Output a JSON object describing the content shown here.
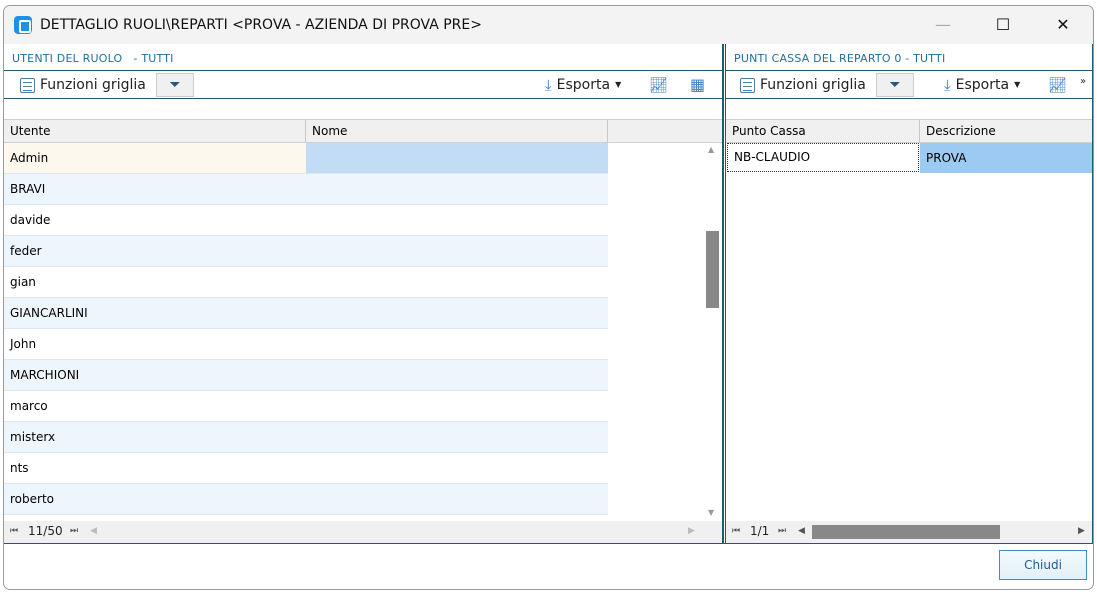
{
  "window": {
    "title": "DETTAGLIO RUOLI\\REPARTI <PROVA - AZIENDA DI PROVA PRE>",
    "minimize": "—",
    "maximize": "☐",
    "close": "✕"
  },
  "left": {
    "title": "UTENTI DEL RUOLO   - TUTTI",
    "grid_functions": "Funzioni griglia",
    "export": "Esporta",
    "columns": [
      "Utente",
      "Nome"
    ],
    "rows": [
      "Admin",
      "BRAVI",
      "davide",
      "feder",
      "gian",
      "GIANCARLINI",
      "John",
      "MARCHIONI",
      "marco",
      "misterx",
      "nts",
      "roberto"
    ],
    "pager": "11/50"
  },
  "right": {
    "title": "PUNTI CASSA DEL REPARTO 0 - TUTTI",
    "grid_functions": "Funzioni griglia",
    "export": "Esporta",
    "columns": [
      "Punto Cassa",
      "Descrizione"
    ],
    "rows": [
      {
        "punto": "NB-CLAUDIO",
        "descrizione": "PROVA"
      }
    ],
    "pager": "1/1"
  },
  "close_button": "Chiudi"
}
